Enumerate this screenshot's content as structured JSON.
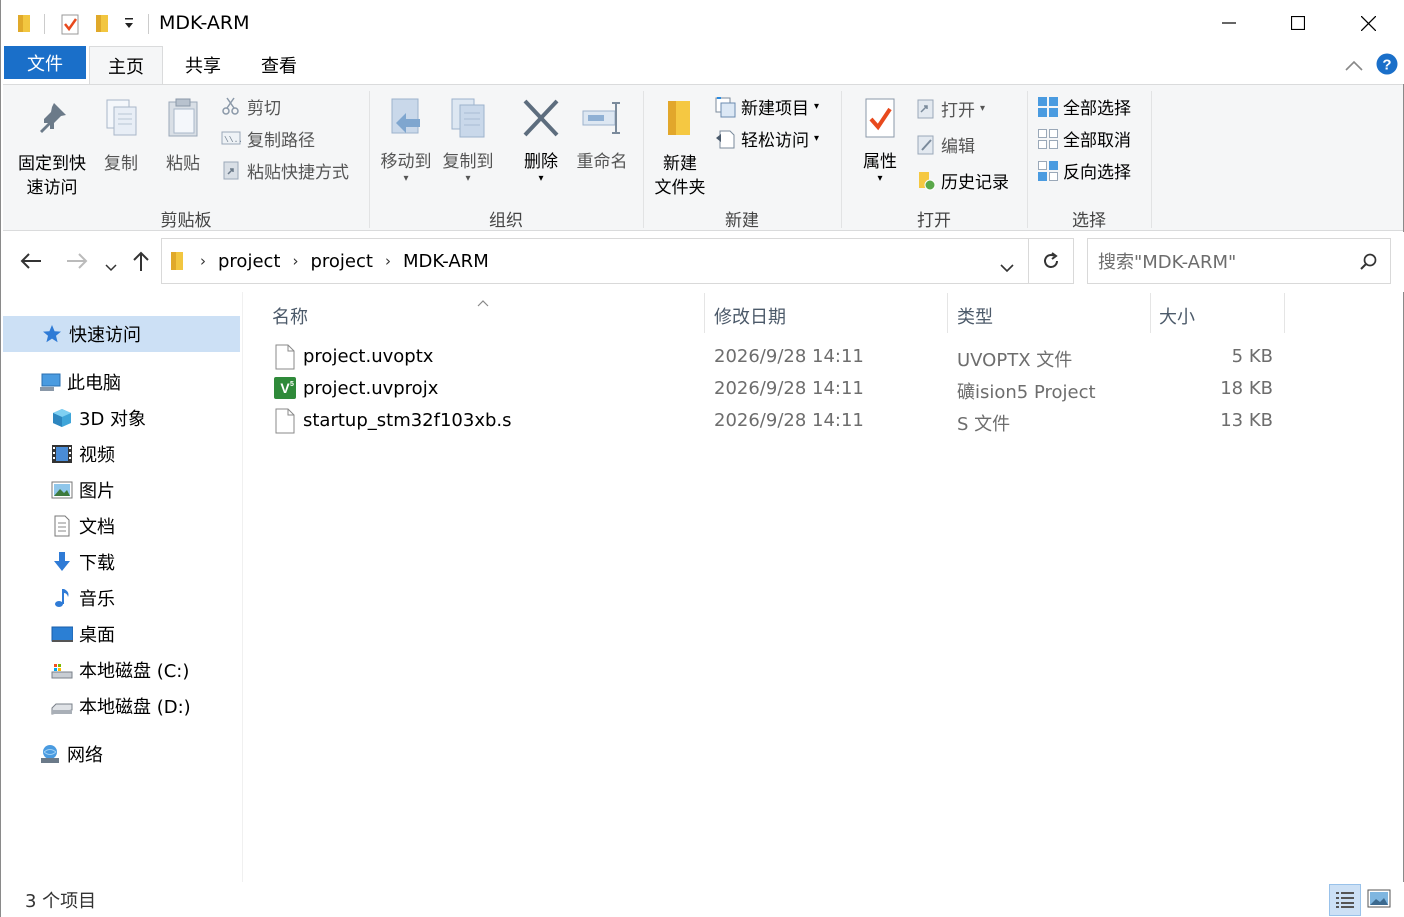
{
  "window": {
    "title": "MDK-ARM",
    "controls": {
      "minimize": "—",
      "maximize": "☐",
      "close": "✕"
    }
  },
  "tabs": {
    "file": "文件",
    "home": "主页",
    "share": "共享",
    "view": "查看"
  },
  "ribbon": {
    "clipboard": {
      "label": "剪贴板",
      "pin_line1": "固定到快",
      "pin_line2": "速访问",
      "copy": "复制",
      "paste": "粘贴",
      "cut": "剪切",
      "copy_path": "复制路径",
      "paste_shortcut": "粘贴快捷方式"
    },
    "organize": {
      "label": "组织",
      "move_to": "移动到",
      "copy_to": "复制到",
      "delete": "删除",
      "rename": "重命名"
    },
    "new": {
      "label": "新建",
      "new_folder_line1": "新建",
      "new_folder_line2": "文件夹",
      "new_item": "新建项目",
      "easy_access": "轻松访问"
    },
    "open": {
      "label": "打开",
      "properties": "属性",
      "open": "打开",
      "edit": "编辑",
      "history": "历史记录"
    },
    "select": {
      "label": "选择",
      "select_all": "全部选择",
      "select_none": "全部取消",
      "invert": "反向选择"
    }
  },
  "address": {
    "crumbs": [
      "project",
      "project",
      "MDK-ARM"
    ],
    "search_placeholder": "搜索\"MDK-ARM\""
  },
  "nav": {
    "quick_access": "快速访问",
    "this_pc": "此电脑",
    "objects_3d": "3D 对象",
    "videos": "视频",
    "pictures": "图片",
    "documents": "文档",
    "downloads": "下载",
    "music": "音乐",
    "desktop": "桌面",
    "drive_c": "本地磁盘 (C:)",
    "drive_d": "本地磁盘 (D:)",
    "network": "网络"
  },
  "columns": {
    "name": "名称",
    "date": "修改日期",
    "type": "类型",
    "size": "大小"
  },
  "files": [
    {
      "name": "project.uvoptx",
      "date": "2026/9/28 14:11",
      "type": "UVOPTX 文件",
      "size": "5 KB",
      "icon": "blank-file-icon"
    },
    {
      "name": "project.uvprojx",
      "date": "2026/9/28 14:11",
      "type": "礦ision5 Project",
      "size": "18 KB",
      "icon": "keil-project-icon"
    },
    {
      "name": "startup_stm32f103xb.s",
      "date": "2026/9/28 14:11",
      "type": "S 文件",
      "size": "13 KB",
      "icon": "blank-file-icon"
    }
  ],
  "status": {
    "item_count": "3 个项目"
  },
  "colors": {
    "accent": "#1a6fc9",
    "selection": "#cce0f5",
    "ribbon_bg": "#f5f6f7"
  }
}
